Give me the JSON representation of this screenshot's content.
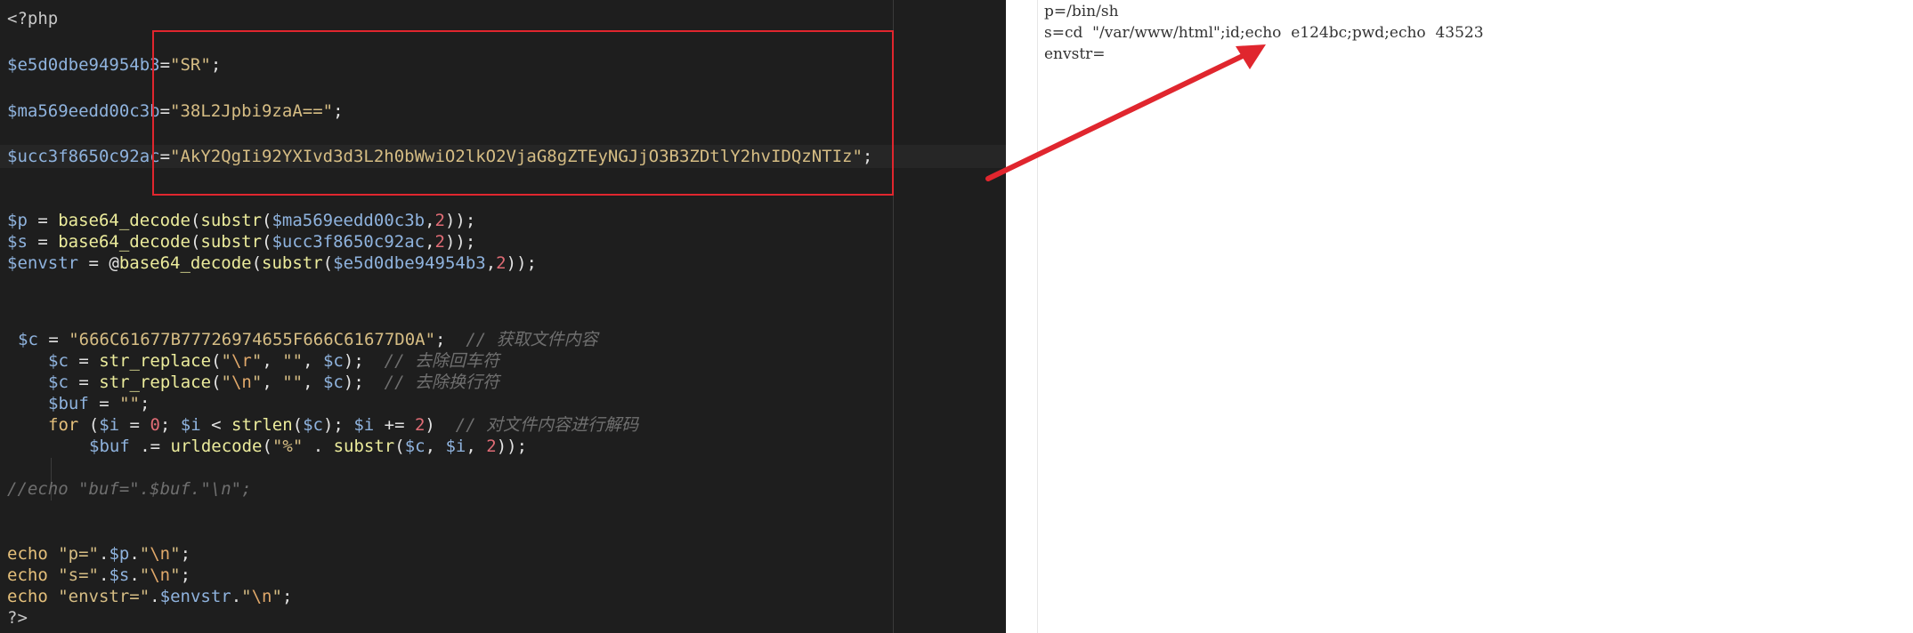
{
  "colors": {
    "editor_background": "#1e1e1e",
    "annotation_red": "#e0262e",
    "variable": "#8fb3de",
    "string": "#d6bd84",
    "function": "#ecec9c",
    "number": "#e06c75",
    "comment": "#6f6f6f"
  },
  "code": {
    "open_tag": "<?php",
    "v1_name": "$e5d0dbe94954b3",
    "v1_value": "\"SR\"",
    "v2_name": "$ma569eedd00c3b",
    "v2_value": "\"38L2Jpbi9zaA==\"",
    "v3_name": "$ucc3f8650c92ac",
    "v3_value": "\"AkY2QgIi92YXIvd3d3L2h0bWwiO2lkO2VjaG8gZTEyNGJjO3B3ZDtlY2hvIDQzNTIz\"",
    "p_var": "$p",
    "s_var": "$s",
    "envstr_var": "$envstr",
    "at_sign": "@",
    "fn_base64": "base64_decode",
    "fn_substr": "substr",
    "num_2": "2",
    "c_var": "$c",
    "c_value": "\"666C61677B77726974655F666C61677D0A\"",
    "comment_get_file": "// 获取文件内容",
    "fn_str_replace": "str_replace",
    "esc_r": "\\r",
    "esc_n": "\\n",
    "empty_str": "\"\"",
    "comment_remove_cr": "// 去除回车符",
    "comment_remove_lf": "// 去除换行符",
    "buf_var": "$buf",
    "kw_for": "for",
    "i_var": "$i",
    "num_0": "0",
    "fn_strlen": "strlen",
    "comment_decode": "// 对文件内容进行解码",
    "fn_urldecode": "urldecode",
    "percent_str": "\"%\"",
    "commented_echo": "//echo \"buf=\".$buf.\"\\n\";",
    "kw_echo": "echo",
    "str_p": "\"p=\"",
    "str_s": "\"s=\"",
    "str_envstr": "\"envstr=\"",
    "close_tag": "?>"
  },
  "output": {
    "line1": "p=/bin/sh",
    "line2": "s=cd  \"/var/www/html\";id;echo  e124bc;pwd;echo  43523",
    "line3": "envstr="
  }
}
